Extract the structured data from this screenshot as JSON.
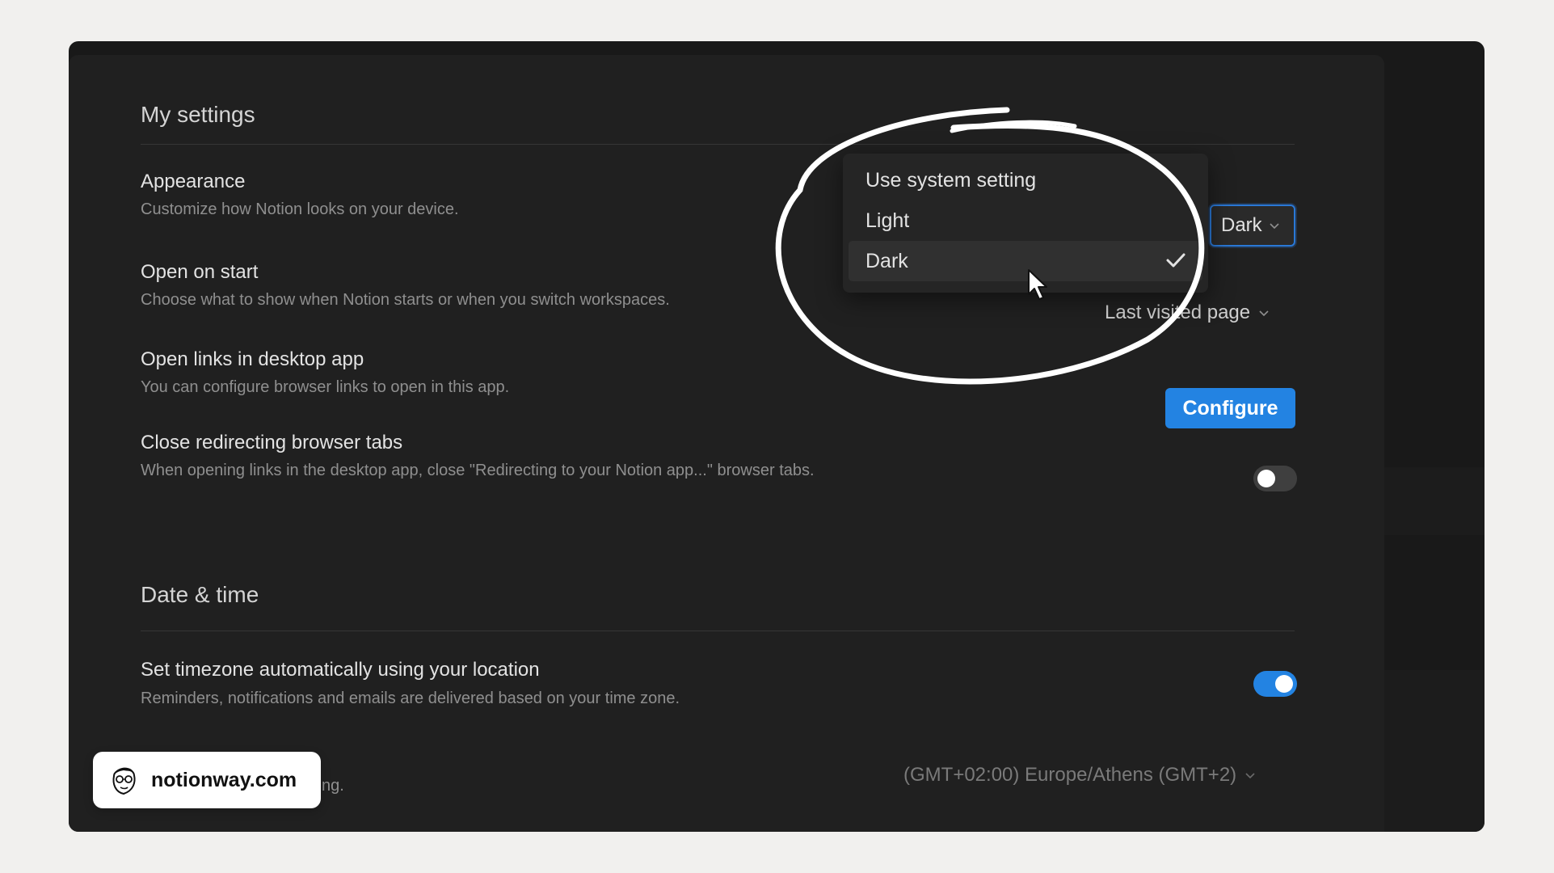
{
  "settings": {
    "section_title": "My settings",
    "appearance": {
      "title": "Appearance",
      "desc": "Customize how Notion looks on your device.",
      "value": "Dark"
    },
    "open_on_start": {
      "title": "Open on start",
      "desc": "Choose what to show when Notion starts or when you switch workspaces.",
      "value": "Last visited page"
    },
    "open_links": {
      "title": "Open links in desktop app",
      "desc": "You can configure browser links to open in this app.",
      "button": "Configure"
    },
    "close_tabs": {
      "title": "Close redirecting browser tabs",
      "desc": "When opening links in the desktop app, close \"Redirecting to your Notion app...\" browser tabs.",
      "enabled": false
    }
  },
  "datetime": {
    "section_title": "Date & time",
    "auto_timezone": {
      "title": "Set timezone automatically using your location",
      "desc": "Reminders, notifications and emails are delivered based on your time zone.",
      "enabled": true
    },
    "timezone": {
      "desc_partial": "ting.",
      "value": "(GMT+02:00) Europe/Athens (GMT+2)"
    }
  },
  "dropdown": {
    "items": [
      {
        "label": "Use system setting",
        "selected": false
      },
      {
        "label": "Light",
        "selected": false
      },
      {
        "label": "Dark",
        "selected": true
      }
    ]
  },
  "badge": {
    "text": "notionway.com",
    "icon": "avatar-icon"
  },
  "colors": {
    "accent": "#2383e2",
    "panel": "#202020",
    "background": "#f1f0ee"
  }
}
